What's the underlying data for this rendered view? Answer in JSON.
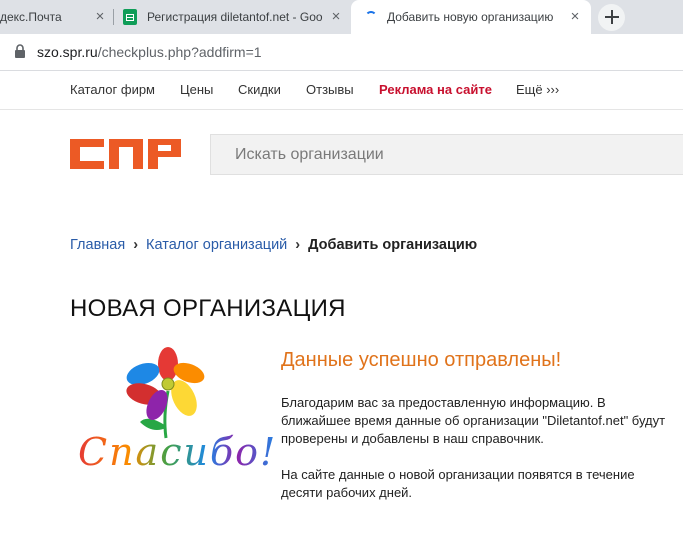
{
  "browser": {
    "tabs": [
      {
        "label": "декс.Почта"
      },
      {
        "label": "Регистрация diletantof.net - Goo"
      },
      {
        "label": "Добавить новую организацию"
      }
    ],
    "address": {
      "host": "szo.spr.ru",
      "path": "/checkplus.php?addfirm=1"
    }
  },
  "topnav": {
    "items": [
      "Каталог фирм",
      "Цены",
      "Скидки",
      "Отзывы",
      "Реклама на сайте",
      "Ещё ›››"
    ]
  },
  "header": {
    "logo_text": "СПР",
    "search_placeholder": "Искать организации"
  },
  "breadcrumb": {
    "home": "Главная",
    "catalog": "Каталог организаций",
    "current": "Добавить организацию"
  },
  "page": {
    "title": "НОВАЯ ОРГАНИЗАЦИЯ",
    "thanks_image_text": "Спасибо!",
    "success_heading": "Данные успешно отправлены!",
    "message1": "Благодарим вас за предоставленную информацию. В ближайшее время данные об организации \"Diletantof.net\" будут проверены и добавлены в наш справочник.",
    "message2": "На сайте данные о новой организации появятся в течение десяти рабочих дней."
  },
  "colors": {
    "logo": "#ec5a25",
    "ad_link": "#c8102e",
    "link": "#2a5ca8",
    "success": "#e0731b"
  }
}
